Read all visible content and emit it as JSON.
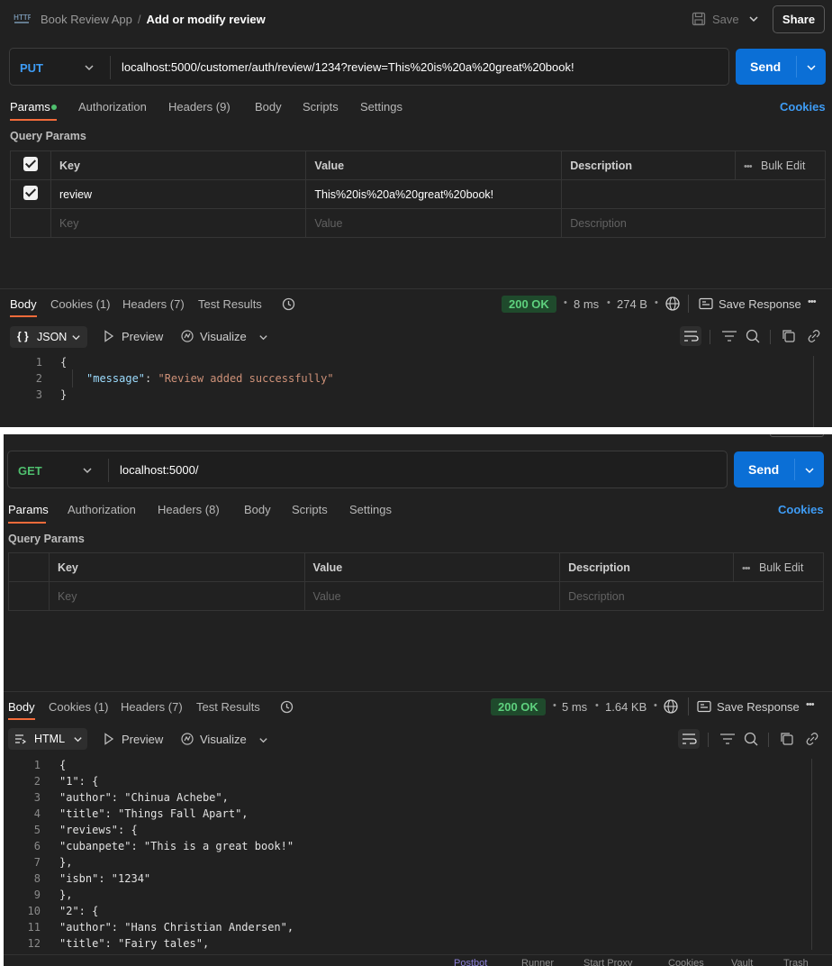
{
  "top_panel": {
    "breadcrumb": {
      "collection": "Book Review App",
      "request": "Add or modify review"
    },
    "save_label": "Save",
    "share_label": "Share",
    "method": "PUT",
    "url": "localhost:5000/customer/auth/review/1234?review=This%20is%20a%20great%20book!",
    "send_label": "Send",
    "tabs": {
      "params": "Params",
      "authorization": "Authorization",
      "headers": "Headers",
      "headers_count": "(9)",
      "body": "Body",
      "scripts": "Scripts",
      "settings": "Settings"
    },
    "cookies_link": "Cookies",
    "query_params_title": "Query Params",
    "table": {
      "headers": {
        "key": "Key",
        "value": "Value",
        "description": "Description",
        "bulk_edit": "Bulk Edit"
      },
      "rows": [
        {
          "key": "review",
          "value": "This%20is%20a%20great%20book!",
          "description": ""
        }
      ],
      "placeholders": {
        "key": "Key",
        "value": "Value",
        "description": "Description"
      }
    },
    "response": {
      "tabs": {
        "body": "Body",
        "cookies": "Cookies",
        "cookies_count": "(1)",
        "headers": "Headers",
        "headers_count": "(7)",
        "test_results": "Test Results"
      },
      "status": "200 OK",
      "time": "8 ms",
      "size": "274 B",
      "save_response": "Save Response",
      "format": "JSON",
      "preview": "Preview",
      "visualize": "Visualize",
      "lines": [
        "1",
        "2",
        "3"
      ],
      "code": {
        "open": "{",
        "key": "\"message\"",
        "colon": ": ",
        "value": "\"Review added successfully\"",
        "close": "}"
      }
    }
  },
  "bottom_panel": {
    "method": "GET",
    "url": "localhost:5000/",
    "send_label": "Send",
    "tabs": {
      "params": "Params",
      "authorization": "Authorization",
      "headers": "Headers",
      "headers_count": "(8)",
      "body": "Body",
      "scripts": "Scripts",
      "settings": "Settings"
    },
    "cookies_link": "Cookies",
    "query_params_title": "Query Params",
    "table": {
      "headers": {
        "key": "Key",
        "value": "Value",
        "description": "Description",
        "bulk_edit": "Bulk Edit"
      },
      "placeholders": {
        "key": "Key",
        "value": "Value",
        "description": "Description"
      }
    },
    "response": {
      "tabs": {
        "body": "Body",
        "cookies": "Cookies",
        "cookies_count": "(1)",
        "headers": "Headers",
        "headers_count": "(7)",
        "test_results": "Test Results"
      },
      "status": "200 OK",
      "time": "5 ms",
      "size": "1.64 KB",
      "save_response": "Save Response",
      "format": "HTML",
      "preview": "Preview",
      "visualize": "Visualize",
      "lines": [
        {
          "n": "1",
          "text": "{"
        },
        {
          "n": "2",
          "text": "\"1\": {"
        },
        {
          "n": "3",
          "text": "\"author\": \"Chinua Achebe\","
        },
        {
          "n": "4",
          "text": "\"title\": \"Things Fall Apart\","
        },
        {
          "n": "5",
          "text": "\"reviews\": {"
        },
        {
          "n": "6",
          "text": "\"cubanpete\": \"This is a great book!\""
        },
        {
          "n": "7",
          "text": "},"
        },
        {
          "n": "8",
          "text": "\"isbn\": \"1234\""
        },
        {
          "n": "9",
          "text": "},"
        },
        {
          "n": "10",
          "text": "\"2\": {"
        },
        {
          "n": "11",
          "text": "\"author\": \"Hans Christian Andersen\","
        },
        {
          "n": "12",
          "text": "\"title\": \"Fairy tales\","
        }
      ]
    },
    "footer": [
      "Postbot",
      "Runner",
      "Start Proxy",
      "Cookies",
      "Vault",
      "Trash"
    ]
  }
}
